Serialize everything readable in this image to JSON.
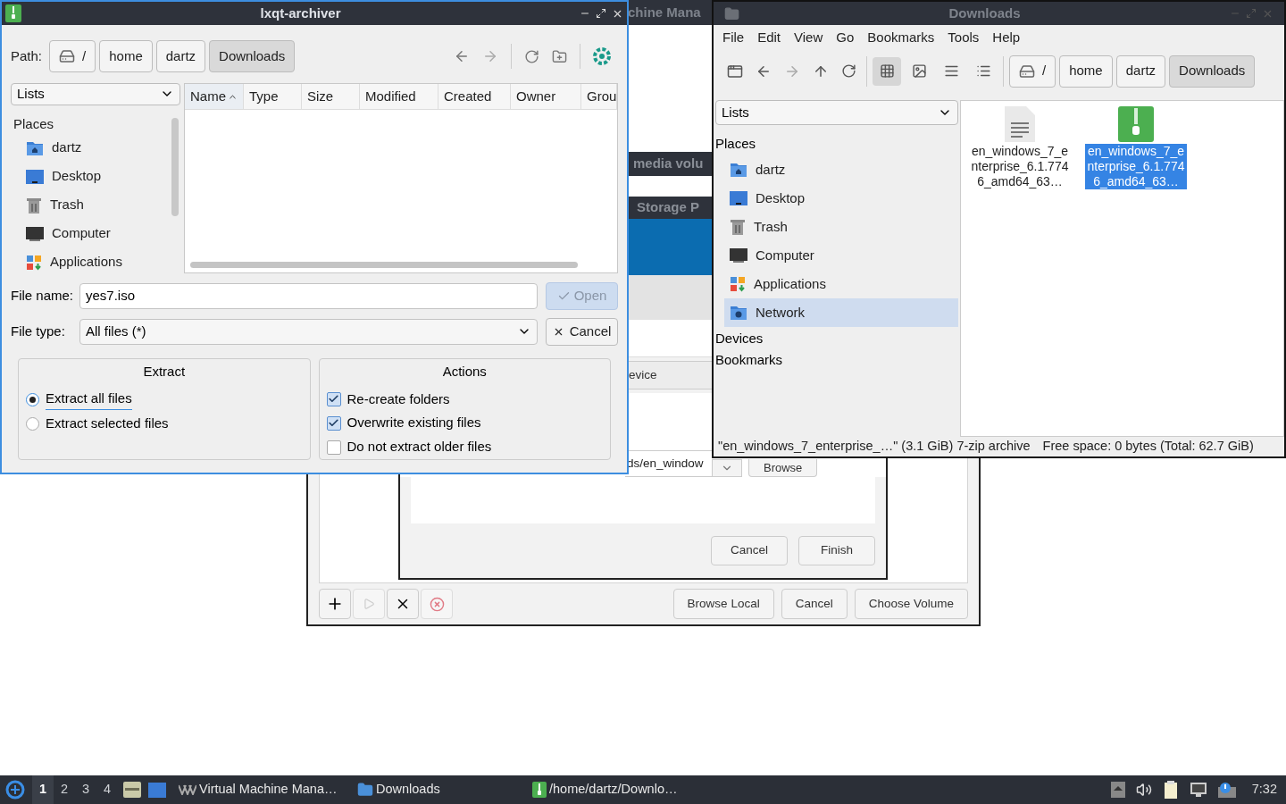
{
  "archiver": {
    "title": "lxqt-archiver",
    "path_label": "Path:",
    "crumbs": [
      {
        "label": "/",
        "kind": "root",
        "selected": false
      },
      {
        "label": "home",
        "kind": "dir",
        "selected": false
      },
      {
        "label": "dartz",
        "kind": "dir",
        "selected": false
      },
      {
        "label": "Downloads",
        "kind": "dir",
        "selected": true
      }
    ],
    "places_combo": "Lists",
    "places_heading": "Places",
    "places": [
      {
        "label": "dartz",
        "kind": "home"
      },
      {
        "label": "Desktop",
        "kind": "desktop"
      },
      {
        "label": "Trash",
        "kind": "trash"
      },
      {
        "label": "Computer",
        "kind": "computer"
      },
      {
        "label": "Applications",
        "kind": "apps"
      }
    ],
    "columns": [
      {
        "label": "Name",
        "sorted": true
      },
      {
        "label": "Type",
        "sorted": false
      },
      {
        "label": "Size",
        "sorted": false
      },
      {
        "label": "Modified",
        "sorted": false
      },
      {
        "label": "Created",
        "sorted": false
      },
      {
        "label": "Owner",
        "sorted": false
      },
      {
        "label": "Grou",
        "sorted": false
      }
    ],
    "file_name_label": "File name:",
    "file_name": "yes7.iso",
    "file_type_label": "File type:",
    "file_type": "All files (*)",
    "open_button": {
      "label": "Open",
      "disabled": true
    },
    "cancel_button": {
      "label": "Cancel"
    },
    "extract": {
      "title": "Extract",
      "options": [
        {
          "label": "Extract all files",
          "selected": true
        },
        {
          "label": "Extract selected files",
          "selected": false
        }
      ]
    },
    "actions": {
      "title": "Actions",
      "options": [
        {
          "label": "Re-create folders",
          "checked": true
        },
        {
          "label": "Overwrite existing files",
          "checked": true
        },
        {
          "label": "Do not extract older files",
          "checked": false
        }
      ]
    }
  },
  "file_manager": {
    "title": "Downloads",
    "menu": [
      "File",
      "Edit",
      "View",
      "Go",
      "Bookmarks",
      "Tools",
      "Help"
    ],
    "view_modes": [
      {
        "kind": "icons",
        "selected": true
      },
      {
        "kind": "thumbnails",
        "selected": false
      },
      {
        "kind": "compact",
        "selected": false
      },
      {
        "kind": "details",
        "selected": false
      }
    ],
    "crumbs": [
      {
        "label": "/",
        "kind": "root",
        "selected": false
      },
      {
        "label": "home",
        "kind": "dir",
        "selected": false
      },
      {
        "label": "dartz",
        "kind": "dir",
        "selected": false
      },
      {
        "label": "Downloads",
        "kind": "dir",
        "selected": true
      }
    ],
    "places_combo": "Lists",
    "places_heading": "Places",
    "places": [
      {
        "label": "dartz",
        "kind": "home",
        "selected": false
      },
      {
        "label": "Desktop",
        "kind": "desktop",
        "selected": false
      },
      {
        "label": "Trash",
        "kind": "trash",
        "selected": false
      },
      {
        "label": "Computer",
        "kind": "computer",
        "selected": false
      },
      {
        "label": "Applications",
        "kind": "apps",
        "selected": false
      },
      {
        "label": "Network",
        "kind": "network",
        "selected": true
      }
    ],
    "sections": [
      "Devices",
      "Bookmarks"
    ],
    "files": [
      {
        "name": "en_windows_7_enterprise_6.1.7746_amd64_63…",
        "kind": "text",
        "selected": false
      },
      {
        "name": "en_windows_7_enterprise_6.1.7746_amd64_63…",
        "kind": "archive",
        "selected": true
      }
    ],
    "status": "\"en_windows_7_enterprise_…\" (3.1 GiB) 7-zip archive",
    "free_space": "Free space: 0 bytes (Total: 62.7 GiB)"
  },
  "vm_manager": {
    "title": "chine Mana",
    "volume_dialog_title": "media volu",
    "pool_dialog_title": "Storage P",
    "device_button": "evice",
    "path": "ds/en_window",
    "browse_button": "Browse",
    "wizard_buttons": [
      "Cancel",
      "Finish"
    ],
    "buttons": [
      "Browse Local",
      "Cancel",
      "Choose Volume"
    ]
  },
  "taskbar": {
    "workspaces": [
      {
        "label": "1",
        "selected": true
      },
      {
        "label": "2",
        "selected": false
      },
      {
        "label": "3",
        "selected": false
      },
      {
        "label": "4",
        "selected": false
      }
    ],
    "tasks": [
      {
        "label": "Virtual Machine Mana…",
        "kind": "vm"
      },
      {
        "label": "Downloads",
        "kind": "folder"
      },
      {
        "label": "/home/dartz/Downlo…",
        "kind": "archive"
      }
    ],
    "clock": "7:32"
  }
}
